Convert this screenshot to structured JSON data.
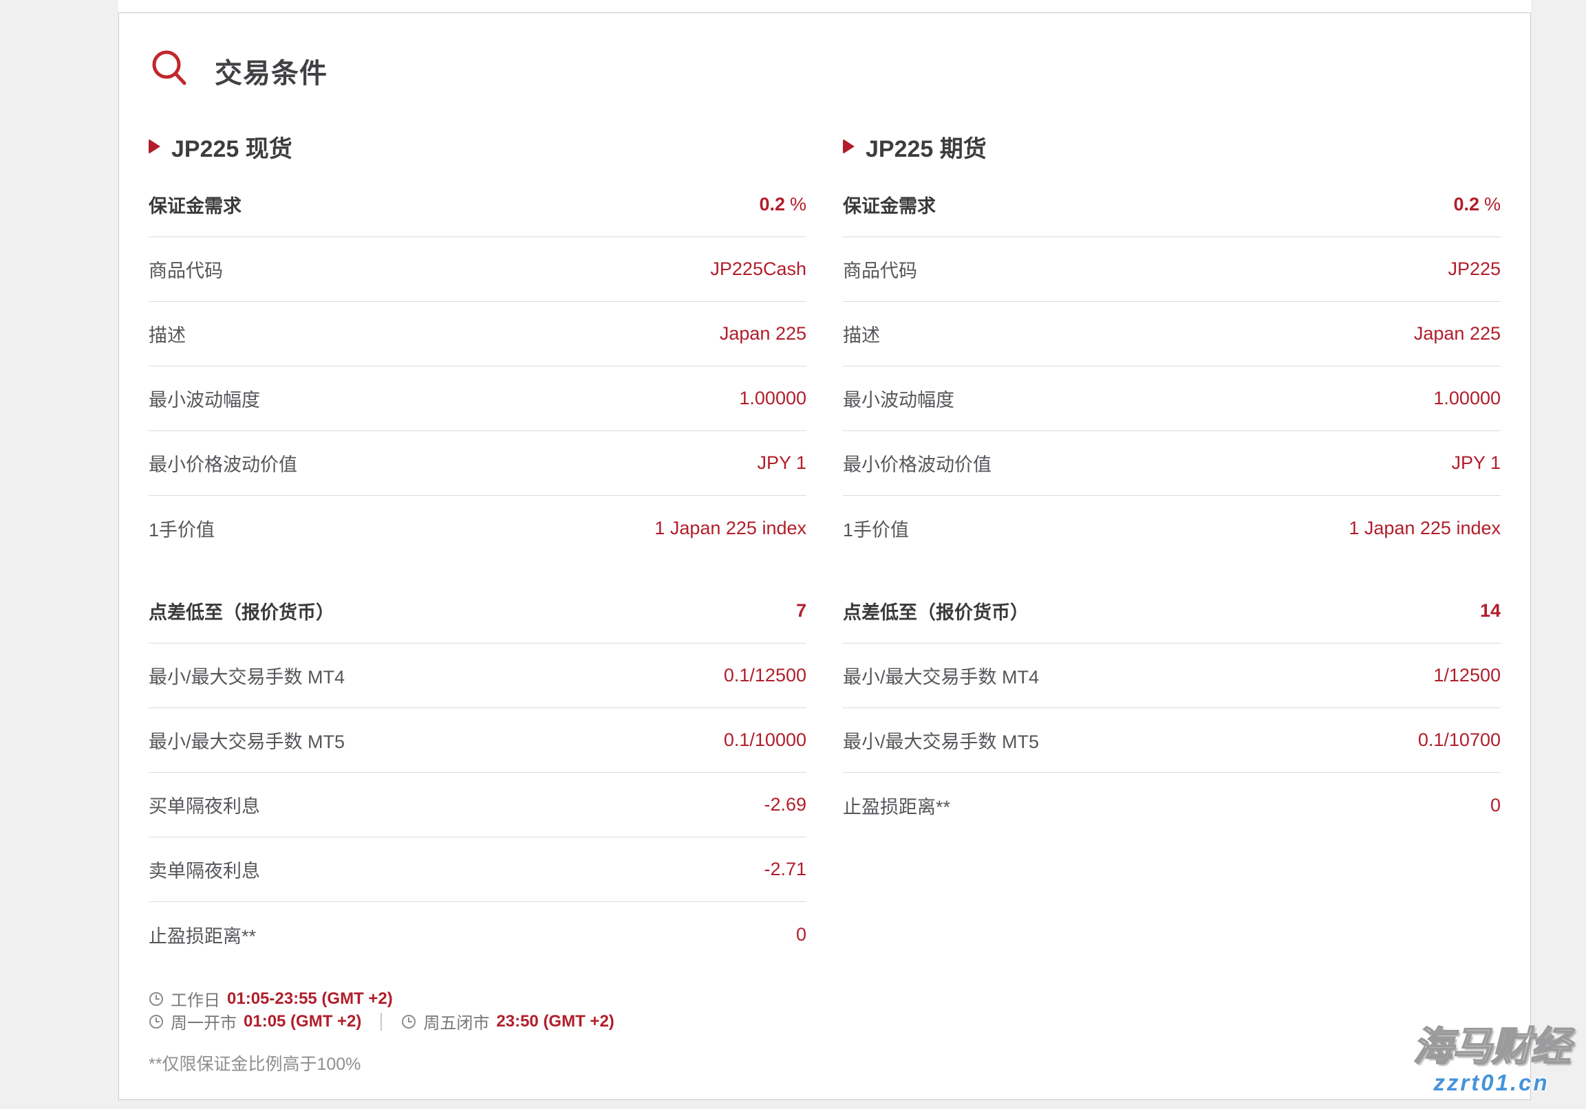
{
  "page": {
    "title": "交易条件"
  },
  "colors": {
    "accent_red": "#b11e2b",
    "watermark_blue": "#4593d9",
    "label_gray": "#55565a"
  },
  "col1": {
    "header": "JP225 现货",
    "g1": [
      {
        "label": "保证金需求",
        "value": "0.2",
        "suffix": "%"
      },
      {
        "label": "商品代码",
        "value": "JP225Cash"
      },
      {
        "label": "描述",
        "value": "Japan 225"
      },
      {
        "label": "最小波动幅度",
        "value": "1.00000"
      },
      {
        "label": "最小价格波动价值",
        "value": "JPY 1"
      },
      {
        "label": "1手价值",
        "value": "1 Japan 225 index"
      }
    ],
    "g2": [
      {
        "label": "点差低至（报价货币）",
        "value": "7"
      },
      {
        "label": "最小/最大交易手数 MT4",
        "value": "0.1/12500"
      },
      {
        "label": "最小/最大交易手数 MT5",
        "value": "0.1/10000"
      },
      {
        "label": "买单隔夜利息",
        "value": "-2.69"
      },
      {
        "label": "卖单隔夜利息",
        "value": "-2.71"
      },
      {
        "label": "止盈损距离**",
        "value": "0"
      }
    ]
  },
  "col2": {
    "header": "JP225 期货",
    "g1": [
      {
        "label": "保证金需求",
        "value": "0.2",
        "suffix": "%"
      },
      {
        "label": "商品代码",
        "value": "JP225"
      },
      {
        "label": "描述",
        "value": "Japan 225"
      },
      {
        "label": "最小波动幅度",
        "value": "1.00000"
      },
      {
        "label": "最小价格波动价值",
        "value": "JPY 1"
      },
      {
        "label": "1手价值",
        "value": "1 Japan 225 index"
      }
    ],
    "g2": [
      {
        "label": "点差低至（报价货币）",
        "value": "14"
      },
      {
        "label": "最小/最大交易手数 MT4",
        "value": "1/12500"
      },
      {
        "label": "最小/最大交易手数 MT5",
        "value": "0.1/10700"
      },
      {
        "label": "止盈损距离**",
        "value": "0"
      }
    ]
  },
  "footer": {
    "work_label": "工作日",
    "work_time": "01:05-23:55 (GMT +2)",
    "mon_label": "周一开市",
    "mon_time": "01:05 (GMT +2)",
    "fri_label": "周五闭市",
    "fri_time": "23:50 (GMT +2)",
    "note": "**仅限保证金比例高于100%"
  },
  "watermark": {
    "name": "海马财经",
    "site": "zzrt01.cn"
  }
}
